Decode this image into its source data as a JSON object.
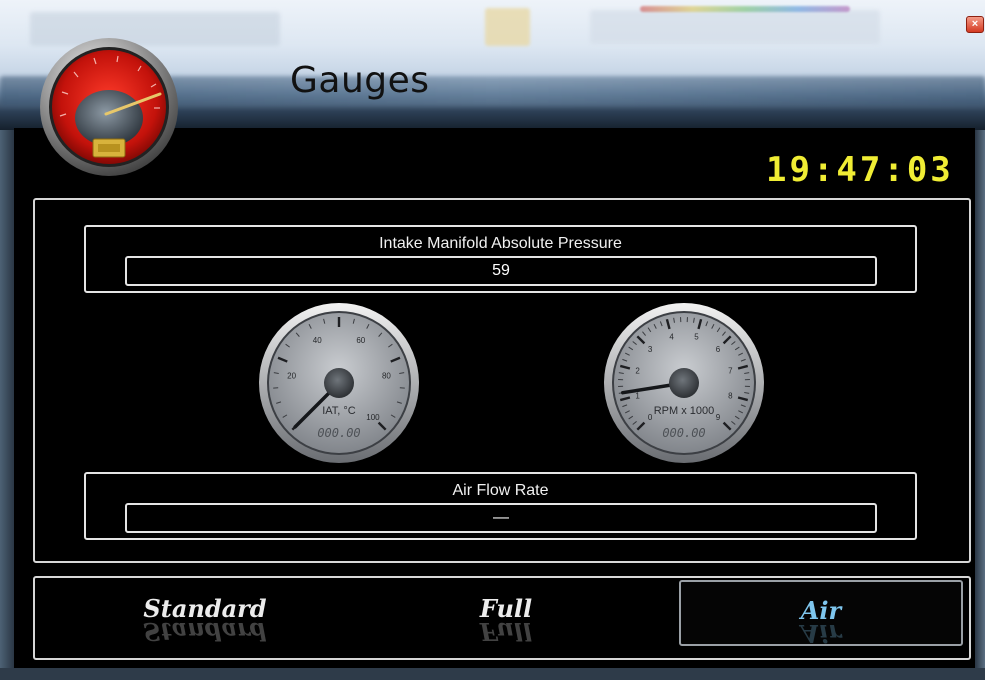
{
  "window": {
    "title": "Gauges",
    "close_glyph": "×",
    "logo_icon": "speedometer-icon"
  },
  "clock": {
    "time": "19:47:03",
    "color": "#f0ed34"
  },
  "sensors": {
    "map": {
      "label": "Intake Manifold Absolute Pressure",
      "value": "59"
    },
    "air_flow": {
      "label": "Air Flow Rate",
      "value": "—"
    }
  },
  "gauges": {
    "iat": {
      "label": "IAT, °C",
      "readout": "000.00",
      "min": 0,
      "max": 100,
      "ticks": [
        "20",
        "40",
        "60",
        "80",
        "100"
      ],
      "value": 0
    },
    "rpm": {
      "label": "RPM x 1000",
      "readout": "000.00",
      "min": 0,
      "max": 9,
      "ticks": [
        "0",
        "1",
        "2",
        "3",
        "4",
        "5",
        "6",
        "7",
        "8",
        "9"
      ],
      "value": 1.2
    }
  },
  "modes": {
    "standard": "Standard",
    "full": "Full",
    "air": "Air",
    "selected": "air",
    "selected_color": "#7ec6ee"
  }
}
